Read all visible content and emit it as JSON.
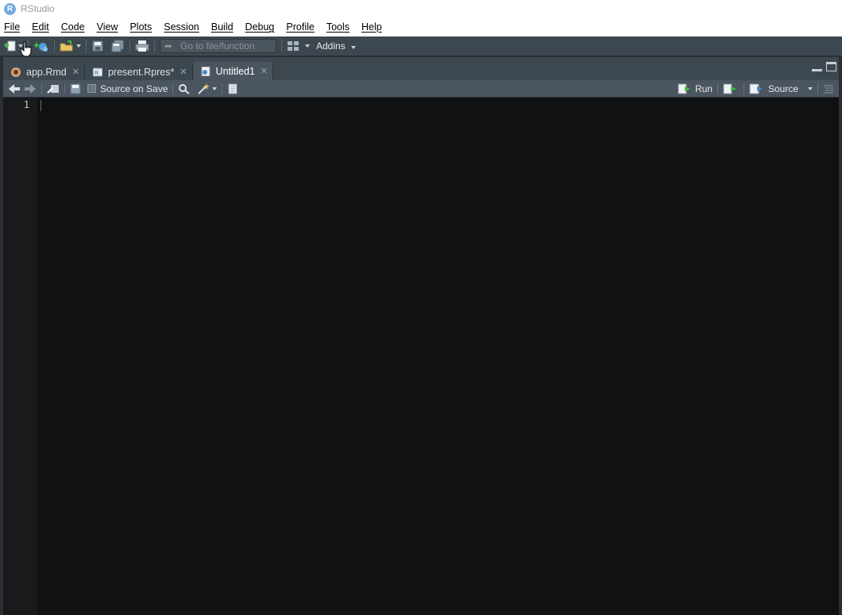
{
  "window": {
    "title": "RStudio"
  },
  "menu": [
    "File",
    "Edit",
    "Code",
    "View",
    "Plots",
    "Session",
    "Build",
    "Debug",
    "Profile",
    "Tools",
    "Help"
  ],
  "toolbar": {
    "goto_placeholder": "Go to file/function",
    "addins_label": "Addins"
  },
  "tabs": [
    {
      "label": "app.Rmd",
      "icon": "rmarkdown-icon",
      "active": false
    },
    {
      "label": "present.Rpres*",
      "icon": "rpres-icon",
      "active": false
    },
    {
      "label": "Untitled1",
      "icon": "rscript-icon",
      "active": true
    }
  ],
  "editor_toolbar": {
    "source_on_save_label": "Source on Save",
    "run_label": "Run",
    "source_label": "Source"
  },
  "editor": {
    "line_numbers": [
      "1"
    ],
    "content": ""
  },
  "colors": {
    "toolbar_bg": "#3d4750",
    "editor_bg": "#101112",
    "accent": "#75aadb"
  }
}
